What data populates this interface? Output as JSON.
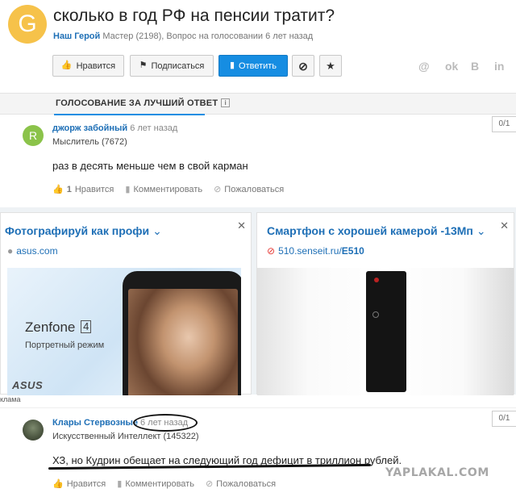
{
  "question": {
    "avatar_letter": "G",
    "title": "сколько в год РФ на пенсии тратит?",
    "author": "Наш Герой",
    "meta": " Мастер (2198), Вопрос на голосовании 6 лет назад"
  },
  "buttons": {
    "like": "Нравится",
    "subscribe": "Подписаться",
    "answer": "Ответить"
  },
  "share_icons": [
    "@",
    "ok",
    "B",
    "in"
  ],
  "tab": {
    "label": "ГОЛОСОВАНИЕ ЗА ЛУЧШИЙ ОТВЕТ",
    "info": "i"
  },
  "answers": [
    {
      "avatar_letter": "R",
      "name": "джорж забойный",
      "time": "6 лет назад",
      "rank": "Мыслитель (7672)",
      "text": "раз в десять меньше чем в свой карман",
      "likes": "1",
      "like_label": "Нравится",
      "comment_label": "Комментировать",
      "report_label": "Пожаловаться",
      "counter": "0/1"
    },
    {
      "avatar_letter": "",
      "name": "Клары Стервозные",
      "time": "6 лет назад",
      "rank": "Искусственный Интеллект (145322)",
      "text": "ХЗ, но Кудрин обещает на следующий год дефицит в триллион рублей.",
      "likes": "",
      "like_label": "Нравится",
      "comment_label": "Комментировать",
      "report_label": "Пожаловаться",
      "counter": "0/1"
    }
  ],
  "ads": [
    {
      "title": "Фотографируй как профи",
      "domain": "asus.com",
      "brand_title": "Zenfone",
      "brand_num": "4",
      "brand_sub": "Портретный режим",
      "logo": "ASUS"
    },
    {
      "title": "Смартфон с хорошей камерой -13Мп",
      "domain": "510.senseit.ru/",
      "domain_bold": "E510"
    }
  ],
  "ad_label": "клама",
  "watermark": "YAPLAKAL.COM"
}
